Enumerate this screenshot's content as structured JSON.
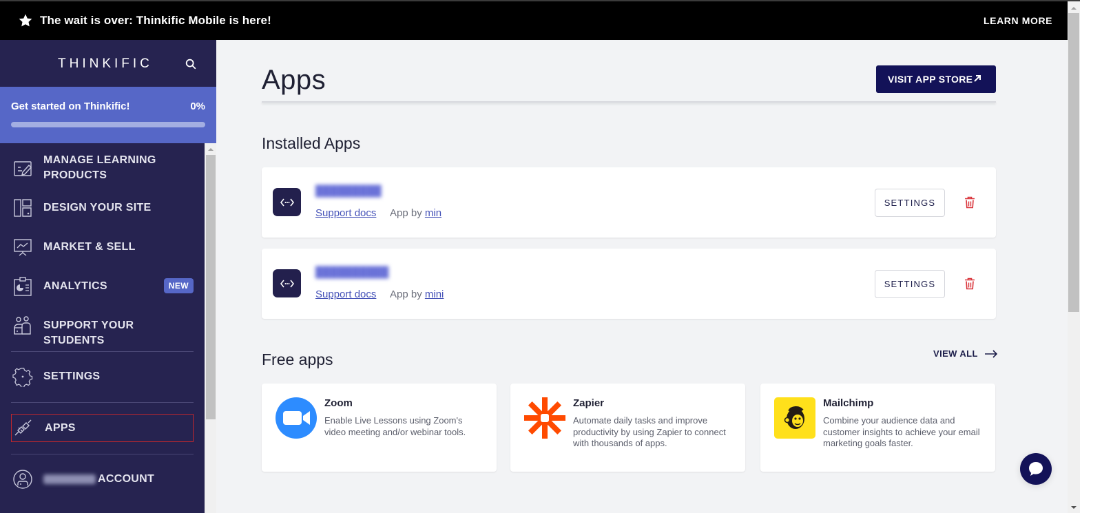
{
  "banner": {
    "message": "The wait is over: Thinkific Mobile is here!",
    "learn_more": "LEARN MORE",
    "icon": "star-icon"
  },
  "sidebar": {
    "brand": "THINKIFIC",
    "search_icon": "search-icon",
    "onboarding": {
      "title": "Get started on Thinkific!",
      "percent_label": "0%",
      "progress": 0
    },
    "items": [
      {
        "label": "MANAGE LEARNING PRODUCTS",
        "line1": "MANAGE LEARNING",
        "line2": "PRODUCTS",
        "icon": "edit-products-icon"
      },
      {
        "label": "DESIGN YOUR SITE",
        "icon": "layout-icon"
      },
      {
        "label": "MARKET & SELL",
        "icon": "presentation-chart-icon"
      },
      {
        "label": "ANALYTICS",
        "icon": "analytics-clipboard-icon",
        "badge": "NEW"
      },
      {
        "label": "SUPPORT YOUR STUDENTS",
        "icon": "students-icon"
      },
      {
        "label": "SETTINGS",
        "icon": "gear-icon"
      },
      {
        "label": "APPS",
        "icon": "plug-icon",
        "active": true
      },
      {
        "label": "ACCOUNT",
        "icon": "user-circle-icon",
        "owner_redacted": true
      }
    ]
  },
  "main": {
    "title": "Apps",
    "visit_store": "VISIT APP STORE",
    "installed_heading": "Installed Apps",
    "installed": [
      {
        "name": "█████████",
        "support_label": "Support docs",
        "app_by_prefix": "App by",
        "author": "min",
        "settings_label": "SETTINGS"
      },
      {
        "name": "██████████",
        "support_label": "Support docs",
        "app_by_prefix": "App by",
        "author": "mini",
        "settings_label": "SETTINGS"
      }
    ],
    "free_heading": "Free apps",
    "view_all": "VIEW ALL",
    "free_apps": [
      {
        "name": "Zoom",
        "description": "Enable Live Lessons using Zoom's video meeting and/or webinar tools.",
        "color": "#2d8cff"
      },
      {
        "name": "Zapier",
        "description": "Automate daily tasks and improve productivity by using Zapier to connect with thousands of apps.",
        "color": "#ff4a00"
      },
      {
        "name": "Mailchimp",
        "description": "Combine your audience data and customer insights to achieve your email marketing goals faster.",
        "color": "#ffe01b"
      }
    ]
  },
  "colors": {
    "sidebar_bg": "#262350",
    "onboarding_bg": "#5667c7",
    "primary_button": "#131258",
    "active_outline": "#c1272d",
    "trash": "#d9343a",
    "link": "#4653b8"
  }
}
